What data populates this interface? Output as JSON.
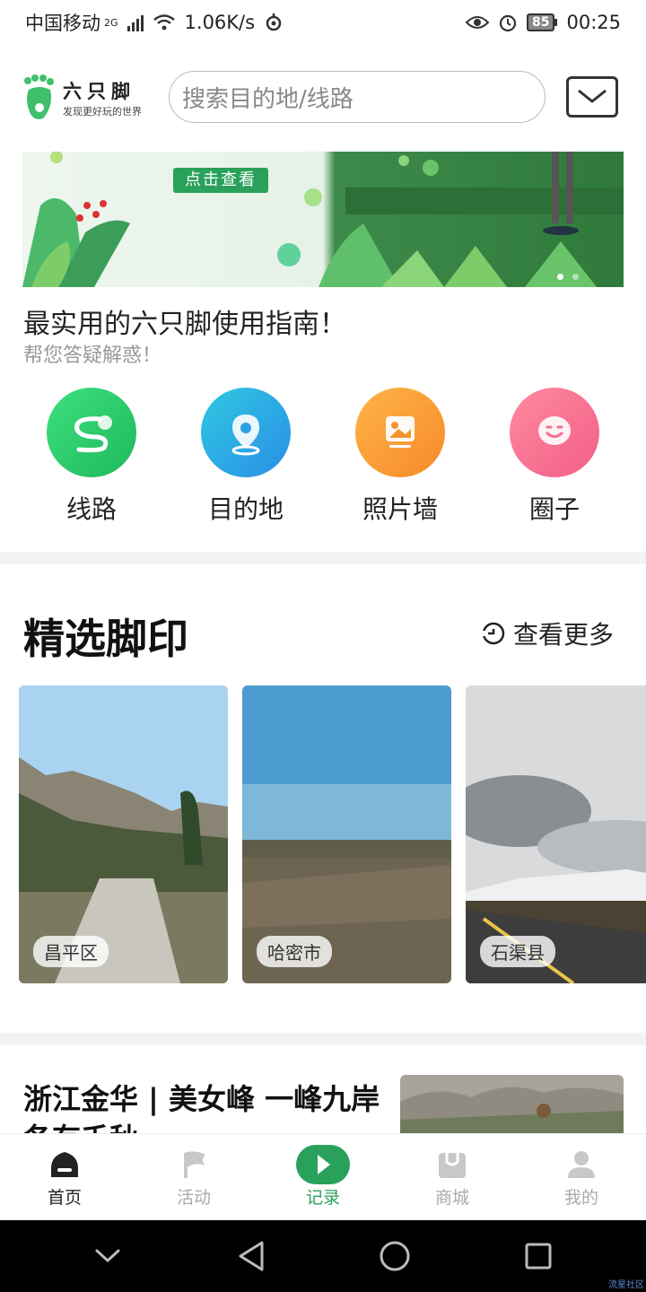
{
  "status_bar": {
    "carrier": "中国移动",
    "network": "2G",
    "speed": "1.06K/s",
    "battery": "85",
    "time": "00:25"
  },
  "header": {
    "logo_title": "六只脚",
    "logo_subtitle": "发现更好玩的世界",
    "search_placeholder": "搜索目的地/线路"
  },
  "banner": {
    "button_label": "点击查看",
    "guide_title": "最实用的六只脚使用指南！",
    "guide_subtitle": "帮您答疑解惑！"
  },
  "shortcuts": [
    {
      "label": "线路",
      "icon": "route-icon",
      "color": "#2ecc71"
    },
    {
      "label": "目的地",
      "icon": "location-pin-icon",
      "color": "#29a9e8"
    },
    {
      "label": "照片墙",
      "icon": "photo-icon",
      "color": "#f7a23a"
    },
    {
      "label": "圈子",
      "icon": "smile-chat-icon",
      "color": "#f56a8a"
    }
  ],
  "featured": {
    "title": "精选脚印",
    "more_label": "查看更多",
    "cards": [
      {
        "location": "昌平区"
      },
      {
        "location": "哈密市"
      },
      {
        "location": "石渠县"
      }
    ]
  },
  "article": {
    "title": "浙江金华 | 美女峰 一峰九岸 各有千秋"
  },
  "tabbar": [
    {
      "label": "首页",
      "icon": "home-icon"
    },
    {
      "label": "活动",
      "icon": "flag-icon"
    },
    {
      "label": "记录",
      "icon": "play-icon"
    },
    {
      "label": "商城",
      "icon": "shop-bag-icon"
    },
    {
      "label": "我的",
      "icon": "user-icon"
    }
  ],
  "watermark": "流星社区",
  "colors": {
    "brand_green": "#2aa15a",
    "active_tab": "#222222",
    "inactive_tab": "#aaaaaa"
  }
}
